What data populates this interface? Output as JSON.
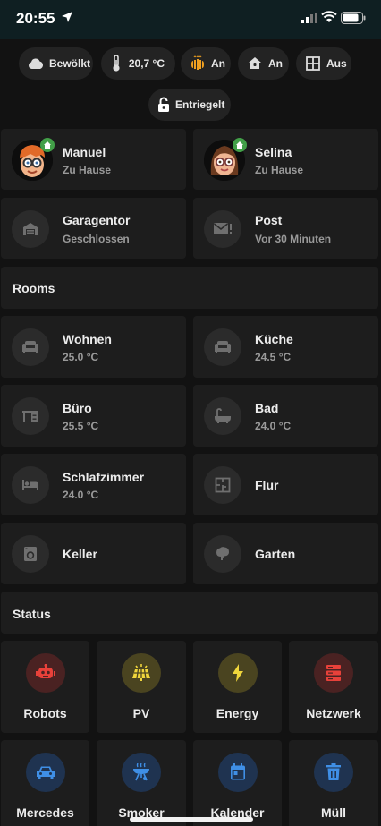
{
  "status_bar": {
    "time": "20:55"
  },
  "chips_row1": [
    {
      "icon": "cloud-icon",
      "label": "Bewölkt"
    },
    {
      "icon": "thermometer-icon",
      "label": "20,7 °C"
    },
    {
      "icon": "heating-icon",
      "label": "An"
    },
    {
      "icon": "house-alarm-icon",
      "label": "An"
    },
    {
      "icon": "window-icon",
      "label": "Aus"
    }
  ],
  "chips_row2": [
    {
      "icon": "lock-icon",
      "label": "Entriegelt"
    }
  ],
  "people": [
    {
      "name": "Manuel",
      "state": "Zu Hause"
    },
    {
      "name": "Selina",
      "state": "Zu Hause"
    }
  ],
  "devices": [
    {
      "name": "Garagentor",
      "state": "Geschlossen",
      "icon": "garage-icon"
    },
    {
      "name": "Post",
      "state": "Vor 30 Minuten",
      "icon": "mail-icon"
    }
  ],
  "rooms_header": "Rooms",
  "rooms": [
    {
      "name": "Wohnen",
      "temp": "25.0 °C",
      "icon": "sofa-icon"
    },
    {
      "name": "Küche",
      "temp": "24.5 °C",
      "icon": "sofa-icon"
    },
    {
      "name": "Büro",
      "temp": "25.5 °C",
      "icon": "desk-icon"
    },
    {
      "name": "Bad",
      "temp": "24.0 °C",
      "icon": "bathtub-icon"
    },
    {
      "name": "Schlafzimmer",
      "temp": "24.0 °C",
      "icon": "bed-icon"
    },
    {
      "name": "Flur",
      "temp": "",
      "icon": "floor-plan-icon"
    },
    {
      "name": "Keller",
      "temp": "",
      "icon": "washing-machine-icon"
    },
    {
      "name": "Garten",
      "temp": "",
      "icon": "tree-icon"
    }
  ],
  "status_header": "Status",
  "status_tiles": [
    {
      "label": "Robots",
      "icon": "robot-icon",
      "color": "#e8413a",
      "bg": "#4a2222"
    },
    {
      "label": "PV",
      "icon": "solar-panel-icon",
      "color": "#f0d63c",
      "bg": "#4a4420"
    },
    {
      "label": "Energy",
      "icon": "lightning-icon",
      "color": "#f0d63c",
      "bg": "#4a4420"
    },
    {
      "label": "Netzwerk",
      "icon": "server-icon",
      "color": "#e8413a",
      "bg": "#4a2222"
    },
    {
      "label": "Mercedes",
      "icon": "car-icon",
      "color": "#3f8fe6",
      "bg": "#1f3350"
    },
    {
      "label": "Smoker",
      "icon": "grill-icon",
      "color": "#3f8fe6",
      "bg": "#1f3350"
    },
    {
      "label": "Kalender",
      "icon": "calendar-icon",
      "color": "#3f8fe6",
      "bg": "#1f3350"
    },
    {
      "label": "Müll",
      "icon": "trash-icon",
      "color": "#3f8fe6",
      "bg": "#1f3350"
    }
  ]
}
